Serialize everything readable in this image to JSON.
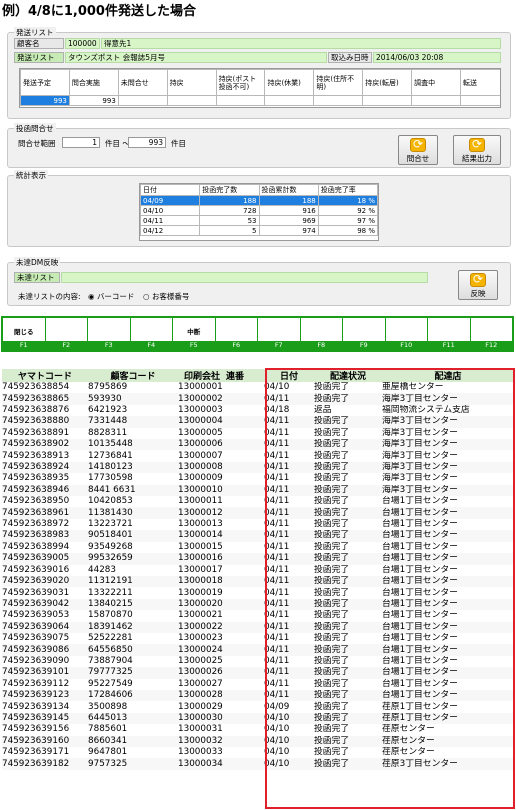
{
  "title": "例）4/8に1,000件発送した場合",
  "send_list": {
    "legend": "発送リスト",
    "customer_label": "顧客名",
    "customer_code": "100000",
    "customer_name": "得意先1",
    "list_label": "発送リスト",
    "list_name": "タウンズポスト 会報誌5月号",
    "import_label": "取込み日時",
    "import_datetime": "2014/06/03 20:08",
    "columns": [
      "発送予定",
      "問合実施",
      "未問合せ",
      "持戻",
      "持戻(ポスト投函不可)",
      "持戻(休業)",
      "持戻(住所不明)",
      "持戻(転居)",
      "調査中",
      "転送"
    ],
    "values": [
      "993",
      "993",
      "",
      "",
      "",
      "",
      "",
      "",
      "",
      ""
    ]
  },
  "inquiry": {
    "legend": "投函問合せ",
    "range_label": "問合せ範囲",
    "from": "1",
    "unit_from": "件目 ～",
    "to": "993",
    "unit_to": "件目",
    "inquiry_button": "問合せ",
    "output_button": "結果出力"
  },
  "stats": {
    "legend": "統計表示",
    "headers": [
      "日付",
      "投函完了数",
      "投函累計数",
      "投函完了率"
    ],
    "rows": [
      [
        "04/09",
        "188",
        "188",
        "18 %"
      ],
      [
        "04/10",
        "728",
        "916",
        "92 %"
      ],
      [
        "04/11",
        "53",
        "969",
        "97 %"
      ],
      [
        "04/12",
        "5",
        "974",
        "98 %"
      ]
    ]
  },
  "undelivered": {
    "legend": "未達DM反映",
    "list_label": "未達リスト",
    "content_label": "未達リストの内容:",
    "opt1": "バーコード",
    "opt2": "お客様番号",
    "reflect_button": "反映"
  },
  "fkeys": {
    "labels": [
      "閉じる",
      "",
      "",
      "",
      "中断",
      "",
      "",
      "",
      "",
      "",
      "",
      ""
    ],
    "keys": [
      "F1",
      "F2",
      "F3",
      "F4",
      "F5",
      "F6",
      "F7",
      "F8",
      "F9",
      "F10",
      "F11",
      "F12"
    ]
  },
  "data_table": {
    "headers": [
      "ヤマトコード",
      "顧客コード",
      "印刷会社",
      "連番",
      "日付",
      "配達状況",
      "配達店"
    ],
    "rows": [
      [
        "745923638854",
        "8795869",
        "13000001",
        "04/10",
        "投函完了",
        "亜屋橋センター"
      ],
      [
        "745923638865",
        "593930",
        "13000002",
        "04/11",
        "投函完了",
        "海岸3丁目センター"
      ],
      [
        "745923638876",
        "6421923",
        "13000003",
        "04/18",
        "返品",
        "福岡物流システム支店"
      ],
      [
        "745923638880",
        "7331448",
        "13000004",
        "04/11",
        "投函完了",
        "海岸3丁目センター"
      ],
      [
        "745923638891",
        "8828311",
        "13000005",
        "04/11",
        "投函完了",
        "海岸3丁目センター"
      ],
      [
        "745923638902",
        "10135448",
        "13000006",
        "04/11",
        "投函完了",
        "海岸3丁目センター"
      ],
      [
        "745923638913",
        "12736841",
        "13000007",
        "04/11",
        "投函完了",
        "海岸3丁目センター"
      ],
      [
        "745923638924",
        "14180123",
        "13000008",
        "04/11",
        "投函完了",
        "海岸3丁目センター"
      ],
      [
        "745923638935",
        "17730598",
        "13000009",
        "04/11",
        "投函完了",
        "海岸3丁目センター"
      ],
      [
        "745923638946",
        "8441 6631",
        "13000010",
        "04/11",
        "投函完了",
        "海岸3丁目センター"
      ],
      [
        "745923638950",
        "10420853",
        "13000011",
        "04/11",
        "投函完了",
        "台場1丁目センター"
      ],
      [
        "745923638961",
        "11381430",
        "13000012",
        "04/11",
        "投函完了",
        "台場1丁目センター"
      ],
      [
        "745923638972",
        "13223721",
        "13000013",
        "04/11",
        "投函完了",
        "台場1丁目センター"
      ],
      [
        "745923638983",
        "90518401",
        "13000014",
        "04/11",
        "投函完了",
        "台場1丁目センター"
      ],
      [
        "745923638994",
        "93549268",
        "13000015",
        "04/11",
        "投函完了",
        "台場1丁目センター"
      ],
      [
        "745923639005",
        "99532659",
        "13000016",
        "04/11",
        "投函完了",
        "台場1丁目センター"
      ],
      [
        "745923639016",
        "44283",
        "13000017",
        "04/11",
        "投函完了",
        "台場1丁目センター"
      ],
      [
        "745923639020",
        "11312191",
        "13000018",
        "04/11",
        "投函完了",
        "台場1丁目センター"
      ],
      [
        "745923639031",
        "13322211",
        "13000019",
        "04/11",
        "投函完了",
        "台場1丁目センター"
      ],
      [
        "745923639042",
        "13840215",
        "13000020",
        "04/11",
        "投函完了",
        "台場1丁目センター"
      ],
      [
        "745923639053",
        "15870870",
        "13000021",
        "04/11",
        "投函完了",
        "台場1丁目センター"
      ],
      [
        "745923639064",
        "18391462",
        "13000022",
        "04/11",
        "投函完了",
        "台場1丁目センター"
      ],
      [
        "745923639075",
        "52522281",
        "13000023",
        "04/11",
        "投函完了",
        "台場1丁目センター"
      ],
      [
        "745923639086",
        "64556850",
        "13000024",
        "04/11",
        "投函完了",
        "台場1丁目センター"
      ],
      [
        "745923639090",
        "73887904",
        "13000025",
        "04/11",
        "投函完了",
        "台場1丁目センター"
      ],
      [
        "745923639101",
        "79777325",
        "13000026",
        "04/11",
        "投函完了",
        "台場1丁目センター"
      ],
      [
        "745923639112",
        "95227549",
        "13000027",
        "04/11",
        "投函完了",
        "台場1丁目センター"
      ],
      [
        "745923639123",
        "17284606",
        "13000028",
        "04/11",
        "投函完了",
        "台場1丁目センター"
      ],
      [
        "745923639134",
        "3500898",
        "13000029",
        "04/09",
        "投函完了",
        "荏原1丁目センター"
      ],
      [
        "745923639145",
        "6445013",
        "13000030",
        "04/10",
        "投函完了",
        "荏原1丁目センター"
      ],
      [
        "745923639156",
        "7885601",
        "13000031",
        "04/10",
        "投函完了",
        "荏原センター"
      ],
      [
        "745923639160",
        "8660341",
        "13000032",
        "04/10",
        "投函完了",
        "荏原センター"
      ],
      [
        "745923639171",
        "9647801",
        "13000033",
        "04/10",
        "投函完了",
        "荏原センター"
      ],
      [
        "745923639182",
        "9757325",
        "13000034",
        "04/10",
        "投函完了",
        "荏原3丁目センター"
      ]
    ]
  }
}
